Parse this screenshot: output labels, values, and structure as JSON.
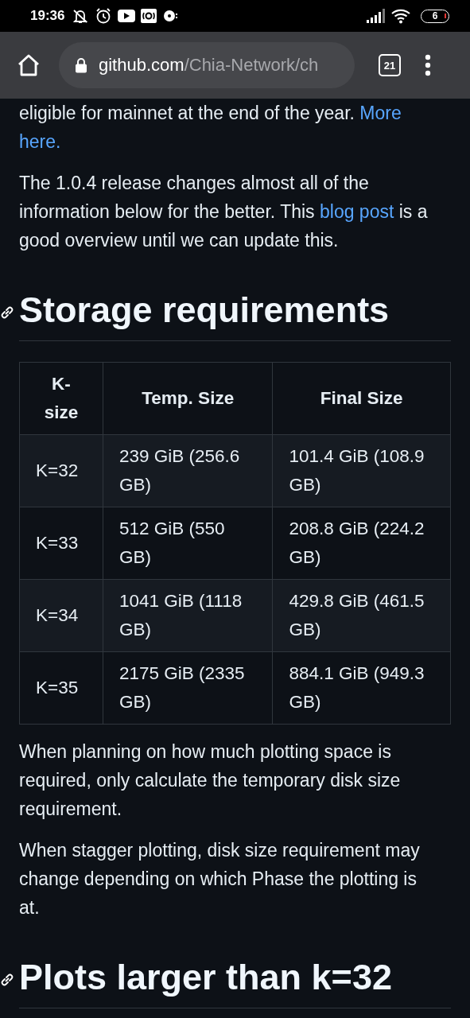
{
  "status_bar": {
    "time": "19:36",
    "battery": "6"
  },
  "browser_toolbar": {
    "url_domain": "github.com",
    "url_path": "/Chia-Network/ch",
    "tab_count": "21"
  },
  "article": [
    {
      "kind": "paragraph",
      "parts": [
        {
          "kind": "text",
          "text": "eligible for mainnet at the end of the year. "
        },
        {
          "kind": "link",
          "text": "More"
        },
        {
          "kind": "link",
          "text": "here."
        }
      ]
    },
    {
      "kind": "paragraph",
      "parts": [
        {
          "kind": "text",
          "text": "The 1.0.4 release changes almost all of the information below for the better. This "
        },
        {
          "kind": "link",
          "text": "blog post"
        },
        {
          "kind": "text",
          "text": " is a good overview until we can update this."
        }
      ]
    },
    {
      "kind": "heading",
      "text": "Storage requirements"
    },
    {
      "kind": "table",
      "columns": [
        "K-size",
        "Temp. Size",
        "Final Size"
      ],
      "rows": [
        [
          "K=32",
          "239 GiB (256.6 GB)",
          "101.4 GiB (108.9 GB)"
        ],
        [
          "K=33",
          "512 GiB (550 GB)",
          "208.8 GiB (224.2 GB)"
        ],
        [
          "K=34",
          "1041 GiB (1118 GB)",
          "429.8 GiB (461.5 GB)"
        ],
        [
          "K=35",
          "2175 GiB (2335 GB)",
          "884.1 GiB (949.3 GB)"
        ]
      ]
    },
    {
      "kind": "paragraph",
      "parts": [
        {
          "kind": "text",
          "text": "When planning on how much plotting space is required, only calculate the temporary disk size requirement."
        }
      ]
    },
    {
      "kind": "paragraph",
      "parts": [
        {
          "kind": "text",
          "text": "When stagger plotting, disk size requirement may change depending on which Phase the plotting is at."
        }
      ]
    },
    {
      "kind": "heading",
      "text": "Plots larger than k=32"
    }
  ]
}
